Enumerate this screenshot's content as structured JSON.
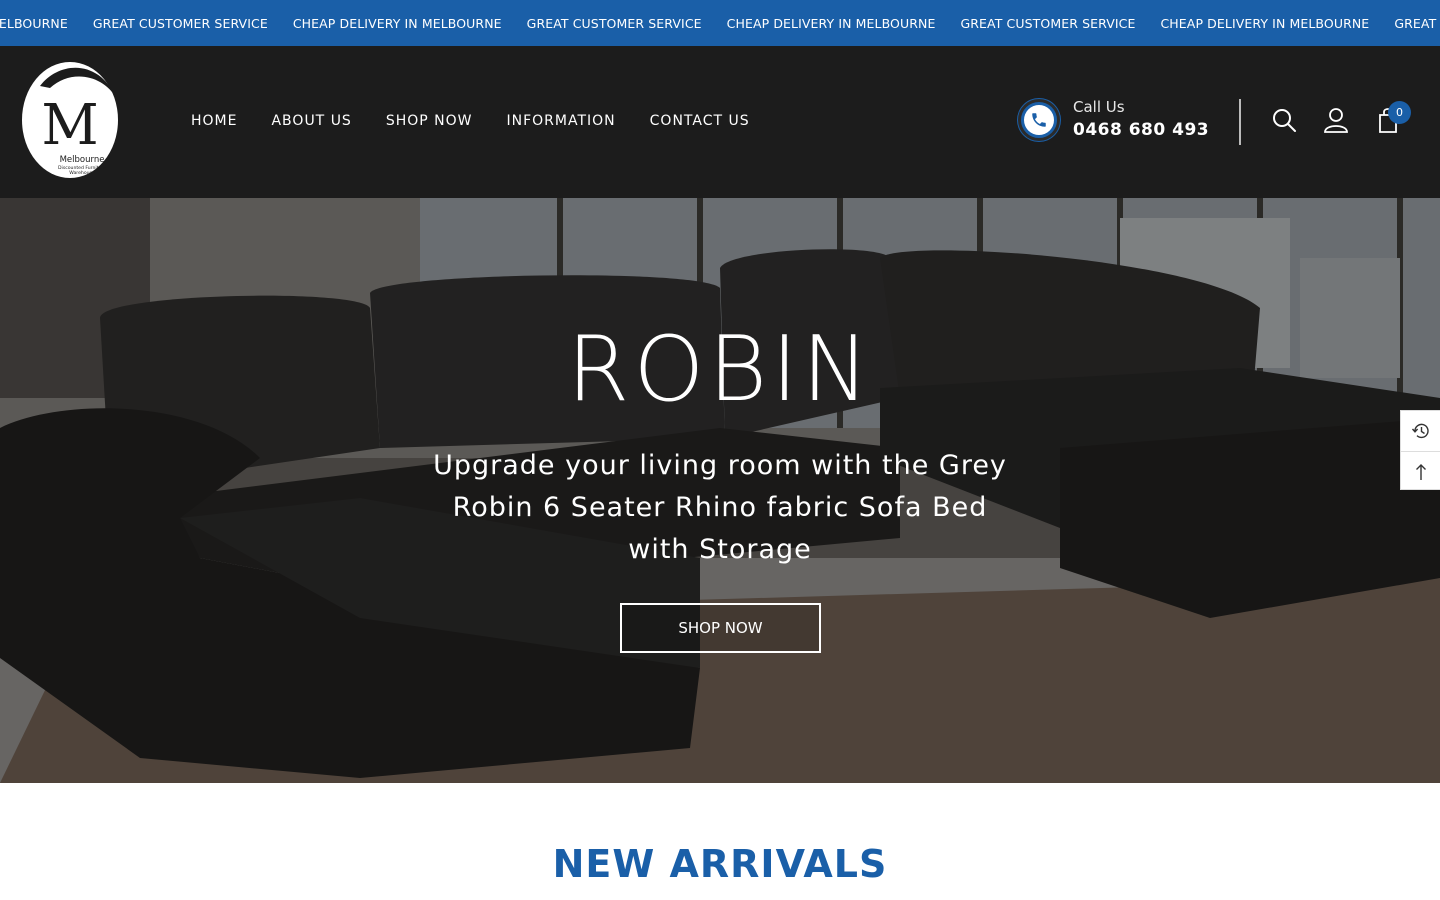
{
  "announcement": {
    "items": [
      "MELBOURNE",
      "GREAT CUSTOMER SERVICE",
      "CHEAP DELIVERY IN MELBOURNE",
      "GREAT CUSTOMER SERVICE",
      "CHEAP DELIVERY IN MELBOURNE",
      "GREAT CUSTOMER SERVICE",
      "CHEAP DELIVERY IN MELBOURNE",
      "GREAT CUS"
    ],
    "bg_color": "#1a5fa8"
  },
  "header": {
    "logo": {
      "letter": "M",
      "line1": "Melbourne",
      "line2": "Discounted Furniture",
      "line3": "Warehouse"
    },
    "nav": [
      {
        "label": "HOME"
      },
      {
        "label": "ABOUT US"
      },
      {
        "label": "SHOP NOW"
      },
      {
        "label": "INFORMATION"
      },
      {
        "label": "CONTACT US"
      }
    ],
    "call": {
      "label": "Call Us",
      "number": "0468 680 493",
      "icon": "phone-icon"
    },
    "icons": [
      "search-icon",
      "account-icon",
      "cart-icon"
    ],
    "cart_count": "0",
    "accent_color": "#1a5fa8"
  },
  "hero": {
    "title": "ROBIN",
    "subtitle": "Upgrade your living room with the Grey Robin 6 Seater Rhino fabric Sofa Bed with Storage",
    "button": "SHOP NOW"
  },
  "side_tools": {
    "icons": [
      "history-icon",
      "arrow-up-icon"
    ]
  },
  "new_arrivals": {
    "title": "NEW ARRIVALS"
  }
}
